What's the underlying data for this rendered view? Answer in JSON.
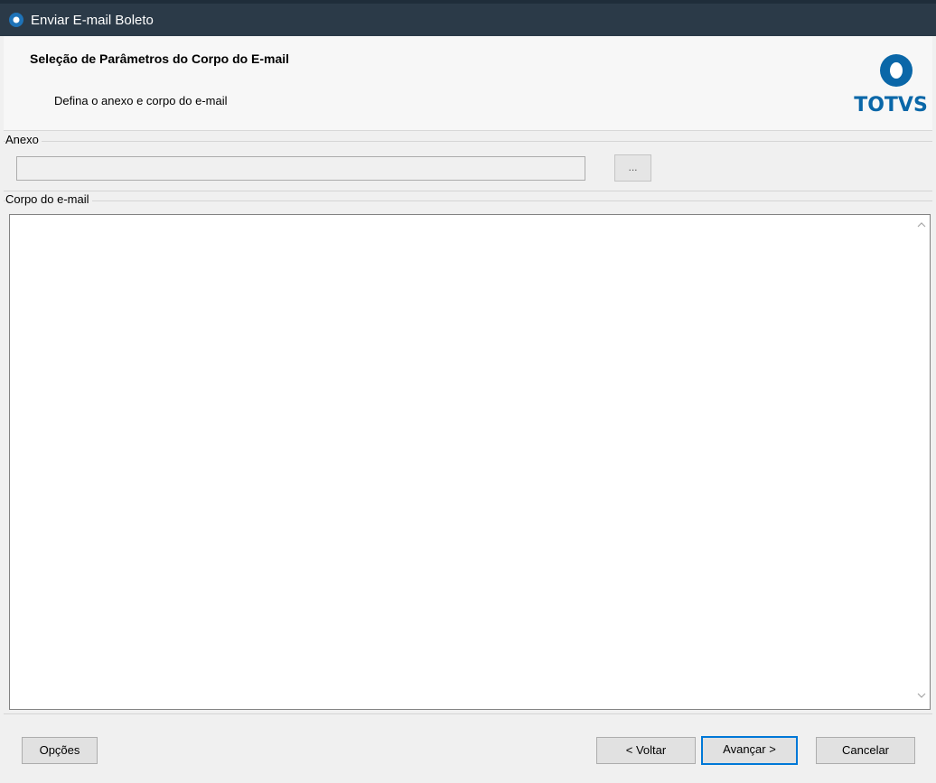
{
  "window": {
    "title": "Enviar E-mail Boleto"
  },
  "header": {
    "title": "Seleção de Parâmetros do Corpo do E-mail",
    "subtitle": "Defina o anexo e corpo do e-mail",
    "logo_text": "TOTVS"
  },
  "anexo": {
    "label": "Anexo",
    "value": "",
    "browse_label": "..."
  },
  "corpo": {
    "label": "Corpo do e-mail",
    "value": ""
  },
  "footer": {
    "options_label": "Opções",
    "back_label": "< Voltar",
    "next_label": "Avançar >",
    "cancel_label": "Cancelar"
  },
  "colors": {
    "titlebar": "#2b3a48",
    "accent": "#0078d7",
    "logo": "#0a67a8"
  },
  "icons": {
    "app": "totvs-app-icon",
    "scroll_up": "chevron-up-icon",
    "scroll_down": "chevron-down-icon"
  }
}
